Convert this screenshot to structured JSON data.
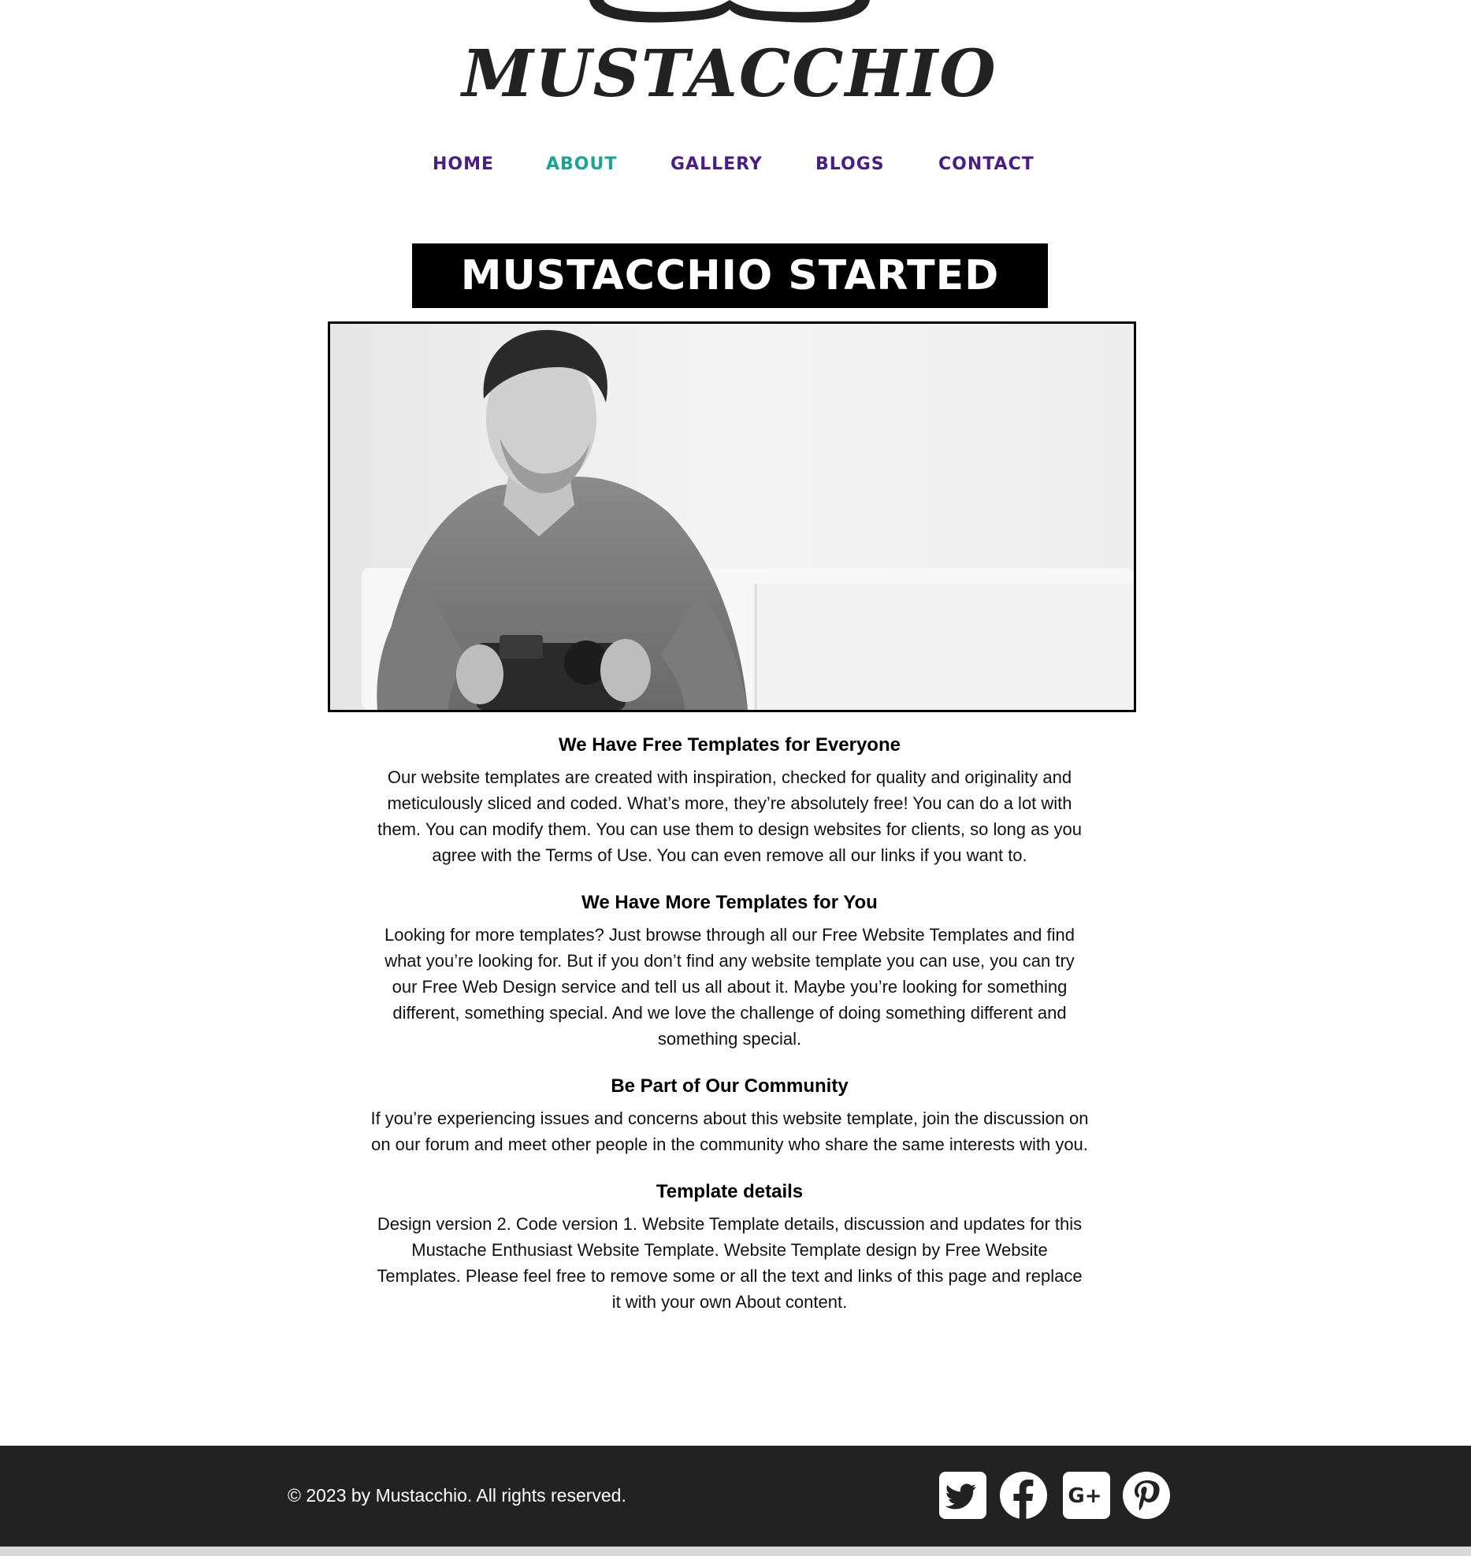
{
  "brand": {
    "logo_text": "MUSTACCHIO"
  },
  "nav": {
    "items": [
      {
        "label": "HOME",
        "active": false
      },
      {
        "label": "ABOUT",
        "active": true
      },
      {
        "label": "GALLERY",
        "active": false
      },
      {
        "label": "BLOGS",
        "active": false
      },
      {
        "label": "CONTACT",
        "active": false
      }
    ]
  },
  "colors": {
    "nav_link": "#4a1c86",
    "nav_active": "#1aa396",
    "banner_bg": "#000000",
    "footer_bg": "#222222"
  },
  "page": {
    "banner_title": "MUSTACCHIO STARTED",
    "hero_image": "man-holding-camera-photo"
  },
  "sections": [
    {
      "heading": "We Have Free Templates for Everyone",
      "body": "Our website templates are created with inspiration, checked for quality and originality and meticulously sliced and coded. What’s more, they’re absolutely free! You can do a lot with them. You can modify them. You can use them to design websites for clients, so long as you agree with the Terms of Use. You can even remove all our links if you want to."
    },
    {
      "heading": "We Have More Templates for You",
      "body": "Looking for more templates? Just browse through all our Free Website Templates and find what you’re looking for. But if you don’t find any website template you can use, you can try our Free Web Design service and tell us all about it. Maybe you’re looking for something different, something special. And we love the challenge of doing something different and something special."
    },
    {
      "heading": "Be Part of Our Community",
      "body": "If you’re experiencing issues and concerns about this website template, join the discussion on on our forum and meet other people in the community who share the same interests with you."
    },
    {
      "heading": "Template details",
      "body": "Design version 2. Code version 1. Website Template details, discussion and updates for this Mustache Enthusiast Website Template. Website Template design by Free Website Templates. Please feel free to remove some or all the text and links of this page and replace it with your own About content."
    }
  ],
  "footer": {
    "copyright": "© 2023 by Mustacchio. All rights reserved.",
    "social": [
      "twitter-icon",
      "facebook-icon",
      "google-plus-icon",
      "pinterest-icon"
    ]
  }
}
